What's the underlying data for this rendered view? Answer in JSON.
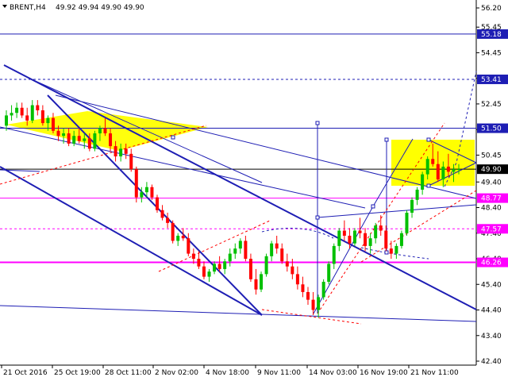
{
  "header": {
    "symbol": "BRENT,H4",
    "ohlc": "49.92 49.94 49.90 49.90"
  },
  "colors": {
    "background": "#ffffff",
    "bull": "#00c000",
    "bear": "#ff0000",
    "level_line": "#1e1eb4",
    "pattern_fill": "#ffff00",
    "magenta": "#ff00ff",
    "current_price_label": "#000000",
    "red_dashed": "#ff0000"
  },
  "chart_data": {
    "type": "candlestick",
    "instrument": "BRENT",
    "timeframe": "H4",
    "ylim": [
      42.4,
      56.2
    ],
    "y_ticks": [
      "56.20",
      "55.45",
      "54.45",
      "53.45",
      "52.45",
      "51.45",
      "50.45",
      "49.40",
      "48.40",
      "47.40",
      "46.40",
      "45.40",
      "44.40",
      "43.40",
      "42.40"
    ],
    "x_ticks": [
      "21 Oct 2016",
      "25 Oct 19:00",
      "28 Oct 11:00",
      "2 Nov 02:00",
      "4 Nov 18:00",
      "9 Nov 11:00",
      "14 Nov 03:00",
      "16 Nov 19:00",
      "21 Nov 11:00"
    ],
    "levels": [
      {
        "value": 55.18,
        "label": "55.18",
        "style": "solid",
        "color": "#1e1eb4"
      },
      {
        "value": 53.41,
        "label": "53.41",
        "style": "dashed",
        "color": "#1e1eb4"
      },
      {
        "value": 51.5,
        "label": "51.50",
        "style": "solid",
        "color": "#1e1eb4"
      },
      {
        "value": 49.9,
        "label": "49.90",
        "style": "solid",
        "color": "#000000"
      },
      {
        "value": 48.77,
        "label": "48.77",
        "style": "solid",
        "color": "#ff00ff"
      },
      {
        "value": 47.57,
        "label": "47.57",
        "style": "dashed",
        "color": "#ff00ff"
      },
      {
        "value": 46.26,
        "label": "46.26",
        "style": "solid",
        "color": "#ff00ff"
      }
    ],
    "candles": [
      [
        51.6,
        52.2,
        51.4,
        52.0
      ],
      [
        52.0,
        52.4,
        51.8,
        52.1
      ],
      [
        52.1,
        52.5,
        51.9,
        52.3
      ],
      [
        52.3,
        52.5,
        51.9,
        52.0
      ],
      [
        52.0,
        52.3,
        51.6,
        51.8
      ],
      [
        51.8,
        52.6,
        51.7,
        52.4
      ],
      [
        52.4,
        52.6,
        52.0,
        52.2
      ],
      [
        52.2,
        52.4,
        51.6,
        51.7
      ],
      [
        51.7,
        52.0,
        51.4,
        51.9
      ],
      [
        51.9,
        52.1,
        51.3,
        51.4
      ],
      [
        51.4,
        51.6,
        51.0,
        51.2
      ],
      [
        51.2,
        51.5,
        50.9,
        51.3
      ],
      [
        51.3,
        51.5,
        50.8,
        50.9
      ],
      [
        50.9,
        51.4,
        50.8,
        51.2
      ],
      [
        51.2,
        51.5,
        50.9,
        51.0
      ],
      [
        51.0,
        51.3,
        50.7,
        51.1
      ],
      [
        51.1,
        51.3,
        50.6,
        50.7
      ],
      [
        50.7,
        51.4,
        50.6,
        51.3
      ],
      [
        51.3,
        51.6,
        51.0,
        51.5
      ],
      [
        51.5,
        51.9,
        51.2,
        51.3
      ],
      [
        51.3,
        51.5,
        50.6,
        50.8
      ],
      [
        50.8,
        51.0,
        50.2,
        50.4
      ],
      [
        50.4,
        50.9,
        50.2,
        50.7
      ],
      [
        50.7,
        50.9,
        50.3,
        50.5
      ],
      [
        50.5,
        50.7,
        49.8,
        49.9
      ],
      [
        49.9,
        50.0,
        48.6,
        48.8
      ],
      [
        48.8,
        49.2,
        48.6,
        49.0
      ],
      [
        49.0,
        49.4,
        48.8,
        49.2
      ],
      [
        49.2,
        49.3,
        48.7,
        48.8
      ],
      [
        48.8,
        48.9,
        48.2,
        48.3
      ],
      [
        48.3,
        48.5,
        47.9,
        48.0
      ],
      [
        48.0,
        48.2,
        47.6,
        47.8
      ],
      [
        47.8,
        47.9,
        47.0,
        47.1
      ],
      [
        47.1,
        47.4,
        46.9,
        47.3
      ],
      [
        47.3,
        47.6,
        47.1,
        47.2
      ],
      [
        47.2,
        47.4,
        46.5,
        46.6
      ],
      [
        46.6,
        46.8,
        46.2,
        46.4
      ],
      [
        46.4,
        46.7,
        46.0,
        46.1
      ],
      [
        46.1,
        46.3,
        45.6,
        45.7
      ],
      [
        45.7,
        46.0,
        45.5,
        45.9
      ],
      [
        45.9,
        46.3,
        45.8,
        46.2
      ],
      [
        46.2,
        46.5,
        45.9,
        46.0
      ],
      [
        46.0,
        46.4,
        45.8,
        46.3
      ],
      [
        46.3,
        46.8,
        46.1,
        46.6
      ],
      [
        46.6,
        47.0,
        46.4,
        46.8
      ],
      [
        46.8,
        47.2,
        46.6,
        47.1
      ],
      [
        47.1,
        47.3,
        46.3,
        46.4
      ],
      [
        46.4,
        46.6,
        45.5,
        45.6
      ],
      [
        45.6,
        46.0,
        45.0,
        45.2
      ],
      [
        45.2,
        45.9,
        45.1,
        45.8
      ],
      [
        45.8,
        46.6,
        45.7,
        46.5
      ],
      [
        46.5,
        47.1,
        46.3,
        47.0
      ],
      [
        47.0,
        47.3,
        46.6,
        46.8
      ],
      [
        46.8,
        47.0,
        46.2,
        46.3
      ],
      [
        46.3,
        46.6,
        45.9,
        46.1
      ],
      [
        46.1,
        46.4,
        45.6,
        45.8
      ],
      [
        45.8,
        46.1,
        45.2,
        45.4
      ],
      [
        45.4,
        45.7,
        44.9,
        45.1
      ],
      [
        45.1,
        45.3,
        44.6,
        44.8
      ],
      [
        44.8,
        45.1,
        44.2,
        44.4
      ],
      [
        44.4,
        45.0,
        44.1,
        44.9
      ],
      [
        44.9,
        45.6,
        44.8,
        45.5
      ],
      [
        45.5,
        46.3,
        45.4,
        46.2
      ],
      [
        46.2,
        47.0,
        46.0,
        46.9
      ],
      [
        46.9,
        47.6,
        46.7,
        47.5
      ],
      [
        47.5,
        47.9,
        47.1,
        47.3
      ],
      [
        47.3,
        47.6,
        46.8,
        47.0
      ],
      [
        47.0,
        47.6,
        46.9,
        47.5
      ],
      [
        47.5,
        48.0,
        47.2,
        47.4
      ],
      [
        47.4,
        47.6,
        46.7,
        46.9
      ],
      [
        46.9,
        47.4,
        46.6,
        47.2
      ],
      [
        47.2,
        47.8,
        47.0,
        47.7
      ],
      [
        47.7,
        48.1,
        47.3,
        47.5
      ],
      [
        47.5,
        47.7,
        46.7,
        46.8
      ],
      [
        46.8,
        47.1,
        46.4,
        46.6
      ],
      [
        46.6,
        47.0,
        46.4,
        46.9
      ],
      [
        46.9,
        47.5,
        46.8,
        47.4
      ],
      [
        47.4,
        48.3,
        47.3,
        48.2
      ],
      [
        48.2,
        48.8,
        48.0,
        48.7
      ],
      [
        48.7,
        49.2,
        48.5,
        49.1
      ],
      [
        49.1,
        49.8,
        48.9,
        49.7
      ],
      [
        49.7,
        50.4,
        49.5,
        50.3
      ],
      [
        50.3,
        50.9,
        50.0,
        50.1
      ],
      [
        50.1,
        50.6,
        49.4,
        49.5
      ],
      [
        49.5,
        50.2,
        49.2,
        50.0
      ],
      [
        50.0,
        50.5,
        49.6,
        49.8
      ],
      [
        49.8,
        50.1,
        49.4,
        49.9
      ],
      [
        49.9,
        50.1,
        49.7,
        49.9
      ]
    ],
    "annotations": [
      "price channel lines",
      "yellow consolidation zones",
      "red dashed trend lines",
      "dashed forecast path to 53.41"
    ]
  }
}
